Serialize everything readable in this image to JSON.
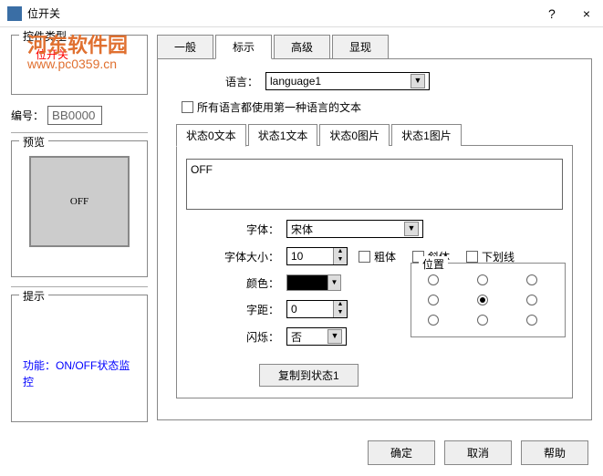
{
  "window": {
    "title": "位开关",
    "help": "?",
    "close": "×"
  },
  "watermark": {
    "line1": "河东软件园",
    "line2": "www.pc0359.cn"
  },
  "left": {
    "control_type_legend": "控件类型",
    "bit_switch_label": "位开关",
    "number_label": "编号：",
    "number_value": "BB0000",
    "preview_legend": "预览",
    "preview_text": "OFF",
    "hint_legend": "提示",
    "hint_text": "功能：ON/OFF状态监控"
  },
  "tabs": [
    "一般",
    "标示",
    "高级",
    "显现"
  ],
  "sign": {
    "language_label": "语言：",
    "language_value": "language1",
    "all_lang_checkbox": "所有语言都使用第一种语言的文本",
    "sub_tabs": [
      "状态0文本",
      "状态1文本",
      "状态0图片",
      "状态1图片"
    ],
    "text_value": "OFF",
    "font_label": "字体：",
    "font_value": "宋体",
    "font_size_label": "字体大小：",
    "font_size_value": "10",
    "bold_label": "粗体",
    "italic_label": "斜体",
    "underline_label": "下划线",
    "color_label": "颜色：",
    "spacing_label": "字距：",
    "spacing_value": "0",
    "blink_label": "闪烁：",
    "blink_value": "否",
    "position_legend": "位置",
    "copy_button": "复制到状态1"
  },
  "buttons": {
    "ok": "确定",
    "cancel": "取消",
    "help": "帮助"
  }
}
